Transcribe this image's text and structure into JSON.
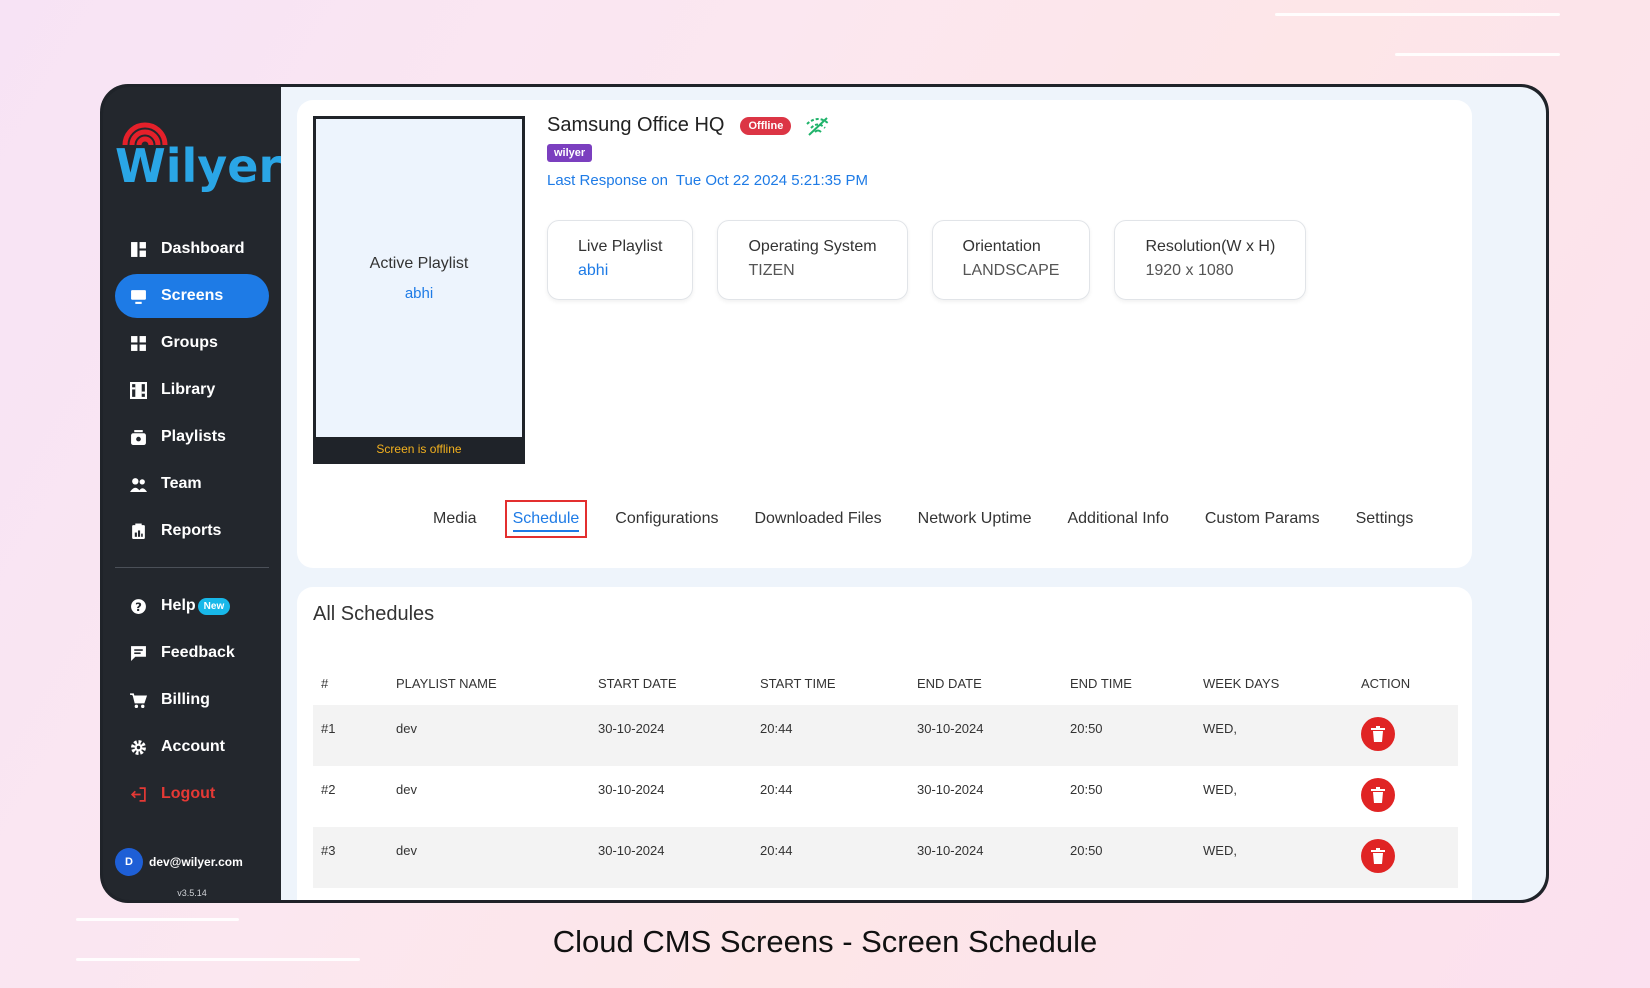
{
  "app": {
    "logo_text": "Wilyer",
    "caption": "Cloud CMS Screens - Screen Schedule"
  },
  "sidebar": {
    "items": [
      {
        "label": "Dashboard",
        "icon": "dashboard-icon",
        "active": false
      },
      {
        "label": "Screens",
        "icon": "monitor-icon",
        "active": true
      },
      {
        "label": "Groups",
        "icon": "grid-icon",
        "active": false
      },
      {
        "label": "Library",
        "icon": "film-icon",
        "active": false
      },
      {
        "label": "Playlists",
        "icon": "playlist-icon",
        "active": false
      },
      {
        "label": "Team",
        "icon": "team-icon",
        "active": false
      },
      {
        "label": "Reports",
        "icon": "report-icon",
        "active": false
      }
    ],
    "secondary": [
      {
        "label": "Help",
        "icon": "help-icon",
        "badge": "New"
      },
      {
        "label": "Feedback",
        "icon": "feedback-icon"
      },
      {
        "label": "Billing",
        "icon": "cart-icon"
      },
      {
        "label": "Account",
        "icon": "gear-icon"
      },
      {
        "label": "Logout",
        "icon": "logout-icon"
      }
    ],
    "user": {
      "initial": "D",
      "email": "dev@wilyer.com",
      "version": "v3.5.14"
    }
  },
  "screen": {
    "preview_title": "Active Playlist",
    "preview_playlist": "abhi",
    "preview_status": "Screen is offline",
    "name": "Samsung Office HQ",
    "status_badge": "Offline",
    "tag": "wilyer",
    "last_response_label": "Last Response on",
    "last_response_value": "Tue Oct 22 2024 5:21:35 PM",
    "info": [
      {
        "label": "Live Playlist",
        "value": "abhi"
      },
      {
        "label": "Operating System",
        "value": "TIZEN"
      },
      {
        "label": "Orientation",
        "value": "LANDSCAPE"
      },
      {
        "label": "Resolution(W x H)",
        "value": "1920 x 1080"
      }
    ]
  },
  "tabs": [
    "Media",
    "Schedule",
    "Configurations",
    "Downloaded Files",
    "Network Uptime",
    "Additional Info",
    "Custom Params",
    "Settings"
  ],
  "active_tab": "Schedule",
  "schedules": {
    "title": "All Schedules",
    "columns": [
      "#",
      "PLAYLIST NAME",
      "START DATE",
      "START TIME",
      "END DATE",
      "END TIME",
      "WEEK DAYS",
      "ACTION"
    ],
    "rows": [
      [
        "#1",
        "dev",
        "30-10-2024",
        "20:44",
        "30-10-2024",
        "20:50",
        "WED,"
      ],
      [
        "#2",
        "dev",
        "30-10-2024",
        "20:44",
        "30-10-2024",
        "20:50",
        "WED,"
      ],
      [
        "#3",
        "dev",
        "30-10-2024",
        "20:44",
        "30-10-2024",
        "20:50",
        "WED,"
      ]
    ]
  },
  "colors": {
    "accent": "#1e7be6",
    "offline": "#dc3545",
    "tag": "#7b3fbf",
    "sidebar": "#23272d"
  }
}
